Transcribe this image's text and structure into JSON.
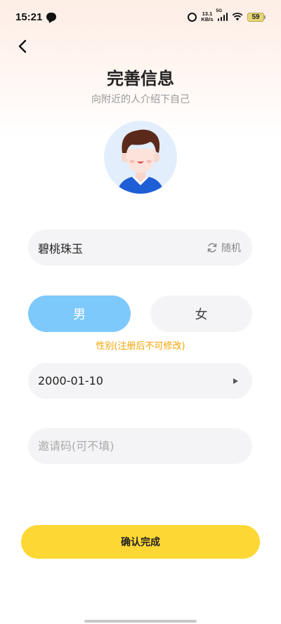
{
  "status_bar": {
    "time": "15:21",
    "net_speed_value": "13.1",
    "net_speed_unit": "KB/s",
    "network_type": "5G",
    "battery_level": "59"
  },
  "header": {
    "title": "完善信息",
    "subtitle": "向附近的人介绍下自己"
  },
  "form": {
    "nickname": {
      "value": "碧桃珠玉",
      "random_label": "随机"
    },
    "gender": {
      "male_label": "男",
      "female_label": "女",
      "selected": "male",
      "note": "性别(注册后不可修改)"
    },
    "birthday": {
      "value": "2000-01-10"
    },
    "invite_code": {
      "placeholder": "邀请码(可不填)",
      "value": ""
    }
  },
  "actions": {
    "confirm_label": "确认完成"
  },
  "colors": {
    "accent_blue": "#7ec9fc",
    "accent_yellow": "#fdd835",
    "note_orange": "#f3a300",
    "field_bg": "#f4f4f6"
  },
  "icons": {
    "back": "back-chevron-icon",
    "random": "refresh-icon",
    "birthday_picker": "play-triangle-icon"
  }
}
